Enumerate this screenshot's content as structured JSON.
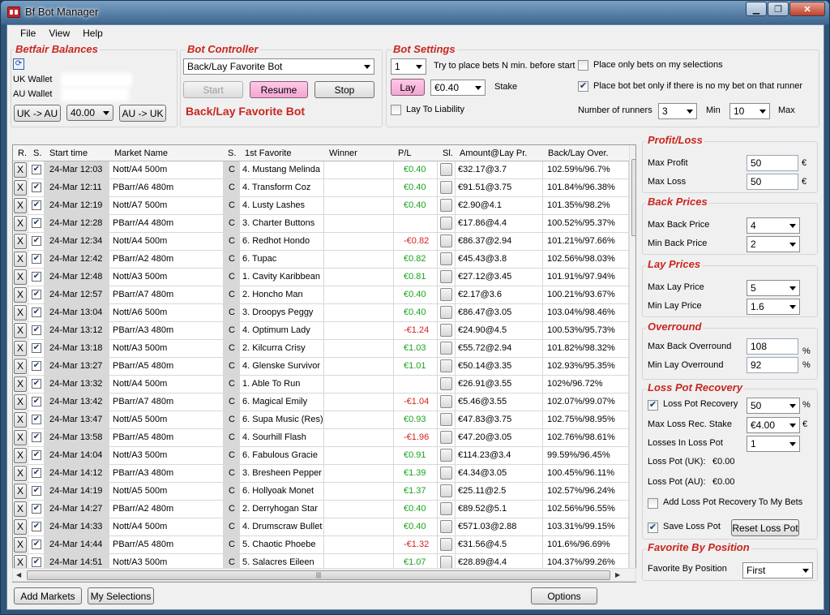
{
  "window": {
    "title": "Bf Bot Manager"
  },
  "menu": {
    "items": [
      "File",
      "View",
      "Help"
    ]
  },
  "balances": {
    "title": "Betfair Balances",
    "uk_label": "UK Wallet",
    "au_label": "AU Wallet",
    "uk_to_au": "UK -> AU",
    "amount": "40.00",
    "au_to_uk": "AU -> UK"
  },
  "controller": {
    "title": "Bot Controller",
    "bot_select": "Back/Lay Favorite Bot",
    "start": "Start",
    "resume": "Resume",
    "stop": "Stop",
    "active_bot": "Back/Lay Favorite Bot"
  },
  "settings": {
    "title": "Bot Settings",
    "minutes": "1",
    "minutes_label": "Try to place bets N min. before start",
    "lay_btn": "Lay",
    "stake": "€0.40",
    "stake_label": "Stake",
    "lay_to_liability": "Lay To Liability",
    "only_selections": "Place only bets on my selections",
    "only_if_no_bet": "Place bot bet only if there is no my bet on that runner",
    "runners_label": "Number of runners",
    "runners_min": "3",
    "min_label": "Min",
    "runners_max": "10",
    "max_label": "Max"
  },
  "grid": {
    "headers": [
      "R.",
      "S.",
      "Start time",
      "Market Name",
      "S.",
      "1st Favorite",
      "Winner",
      "P/L",
      "Sl.",
      "Amount@Lay Pr.",
      "Back/Lay Over."
    ],
    "rows": [
      {
        "time": "24-Mar 12:03",
        "market": "Nott/A4 500m",
        "s": "C",
        "fav": "4. Mustang Melinda",
        "pl": "€0.40",
        "plc": "green",
        "amt": "€32.17@3.7",
        "over": "102.59%/96.7%"
      },
      {
        "time": "24-Mar 12:11",
        "market": "PBarr/A6 480m",
        "s": "C",
        "fav": "4. Transform Coz",
        "pl": "€0.40",
        "plc": "green",
        "amt": "€91.51@3.75",
        "over": "101.84%/96.38%"
      },
      {
        "time": "24-Mar 12:19",
        "market": "Nott/A7 500m",
        "s": "C",
        "fav": "4. Lusty Lashes",
        "pl": "€0.40",
        "plc": "green",
        "amt": "€2.90@4.1",
        "over": "101.35%/98.2%"
      },
      {
        "time": "24-Mar 12:28",
        "market": "PBarr/A4 480m",
        "s": "C",
        "fav": "3. Charter Buttons",
        "pl": "",
        "plc": "",
        "amt": "€17.86@4.4",
        "over": "100.52%/95.37%"
      },
      {
        "time": "24-Mar 12:34",
        "market": "Nott/A4 500m",
        "s": "C",
        "fav": "6. Redhot Hondo",
        "pl": "-€0.82",
        "plc": "red",
        "amt": "€86.37@2.94",
        "over": "101.21%/97.66%"
      },
      {
        "time": "24-Mar 12:42",
        "market": "PBarr/A2 480m",
        "s": "C",
        "fav": "6. Tupac",
        "pl": "€0.82",
        "plc": "green",
        "amt": "€45.43@3.8",
        "over": "102.56%/98.03%"
      },
      {
        "time": "24-Mar 12:48",
        "market": "Nott/A3 500m",
        "s": "C",
        "fav": "1. Cavity Karibbean",
        "pl": "€0.81",
        "plc": "green",
        "amt": "€27.12@3.45",
        "over": "101.91%/97.94%"
      },
      {
        "time": "24-Mar 12:57",
        "market": "PBarr/A7 480m",
        "s": "C",
        "fav": "2. Honcho Man",
        "pl": "€0.40",
        "plc": "green",
        "amt": "€2.17@3.6",
        "over": "100.21%/93.67%"
      },
      {
        "time": "24-Mar 13:04",
        "market": "Nott/A6 500m",
        "s": "C",
        "fav": "3. Droopys Peggy",
        "pl": "€0.40",
        "plc": "green",
        "amt": "€86.47@3.05",
        "over": "103.04%/98.46%"
      },
      {
        "time": "24-Mar 13:12",
        "market": "PBarr/A3 480m",
        "s": "C",
        "fav": "4. Optimum Lady",
        "pl": "-€1.24",
        "plc": "red",
        "amt": "€24.90@4.5",
        "over": "100.53%/95.73%"
      },
      {
        "time": "24-Mar 13:18",
        "market": "Nott/A3 500m",
        "s": "C",
        "fav": "2. Kilcurra Crisy",
        "pl": "€1.03",
        "plc": "green",
        "amt": "€55.72@2.94",
        "over": "101.82%/98.32%"
      },
      {
        "time": "24-Mar 13:27",
        "market": "PBarr/A5 480m",
        "s": "C",
        "fav": "4. Glenske Survivor",
        "pl": "€1.01",
        "plc": "green",
        "amt": "€50.14@3.35",
        "over": "102.93%/95.35%"
      },
      {
        "time": "24-Mar 13:32",
        "market": "Nott/A4 500m",
        "s": "C",
        "fav": "1. Able To Run",
        "pl": "",
        "plc": "",
        "amt": "€26.91@3.55",
        "over": "102%/96.72%"
      },
      {
        "time": "24-Mar 13:42",
        "market": "PBarr/A7 480m",
        "s": "C",
        "fav": "6. Magical Emily",
        "pl": "-€1.04",
        "plc": "red",
        "amt": "€5.46@3.55",
        "over": "102.07%/99.07%"
      },
      {
        "time": "24-Mar 13:47",
        "market": "Nott/A5 500m",
        "s": "C",
        "fav": "6. Supa Music (Res)",
        "pl": "€0.93",
        "plc": "green",
        "amt": "€47.83@3.75",
        "over": "102.75%/98.95%"
      },
      {
        "time": "24-Mar 13:58",
        "market": "PBarr/A5 480m",
        "s": "C",
        "fav": "4. Sourhill Flash",
        "pl": "-€1.96",
        "plc": "red",
        "amt": "€47.20@3.05",
        "over": "102.76%/98.61%"
      },
      {
        "time": "24-Mar 14:04",
        "market": "Nott/A3 500m",
        "s": "C",
        "fav": "6. Fabulous Gracie",
        "pl": "€0.91",
        "plc": "green",
        "amt": "€114.23@3.4",
        "over": "99.59%/96.45%"
      },
      {
        "time": "24-Mar 14:12",
        "market": "PBarr/A3 480m",
        "s": "C",
        "fav": "3. Bresheen Pepper",
        "pl": "€1.39",
        "plc": "green",
        "amt": "€4.34@3.05",
        "over": "100.45%/96.11%"
      },
      {
        "time": "24-Mar 14:19",
        "market": "Nott/A5 500m",
        "s": "C",
        "fav": "6. Hollyoak Monet",
        "pl": "€1.37",
        "plc": "green",
        "amt": "€25.11@2.5",
        "over": "102.57%/96.24%"
      },
      {
        "time": "24-Mar 14:27",
        "market": "PBarr/A2 480m",
        "s": "C",
        "fav": "2. Derryhogan Star",
        "pl": "€0.40",
        "plc": "green",
        "amt": "€89.52@5.1",
        "over": "102.56%/96.55%"
      },
      {
        "time": "24-Mar 14:33",
        "market": "Nott/A4 500m",
        "s": "C",
        "fav": "4. Drumscraw Bullet",
        "pl": "€0.40",
        "plc": "green",
        "amt": "€571.03@2.88",
        "over": "103.31%/99.15%"
      },
      {
        "time": "24-Mar 14:44",
        "market": "PBarr/A5 480m",
        "s": "C",
        "fav": "5. Chaotic Phoebe",
        "pl": "-€1.32",
        "plc": "red",
        "amt": "€31.56@4.5",
        "over": "101.6%/96.69%"
      },
      {
        "time": "24-Mar 14:51",
        "market": "Nott/A3 500m",
        "s": "C",
        "fav": "5. Salacres Eileen",
        "pl": "€1.07",
        "plc": "green",
        "amt": "€28.89@4.4",
        "over": "104.37%/99.26%"
      }
    ]
  },
  "bottom": {
    "add_markets": "Add Markets",
    "my_selections": "My Selections",
    "options": "Options"
  },
  "right": {
    "profit_loss": {
      "title": "Profit/Loss",
      "max_profit_label": "Max Profit",
      "max_profit": "50",
      "max_loss_label": "Max Loss",
      "max_loss": "50",
      "currency": "€"
    },
    "back_prices": {
      "title": "Back Prices",
      "max_label": "Max Back Price",
      "max": "4",
      "min_label": "Min Back Price",
      "min": "2"
    },
    "lay_prices": {
      "title": "Lay Prices",
      "max_label": "Max Lay Price",
      "max": "5",
      "min_label": "Min Lay Price",
      "min": "1.6"
    },
    "overround": {
      "title": "Overround",
      "max_label": "Max Back Overround",
      "max": "108",
      "min_label": "Min Lay Overround",
      "min": "92",
      "pct": "%"
    },
    "loss_pot": {
      "title": "Loss Pot Recovery",
      "recovery_label": "Loss Pot Recovery",
      "recovery": "50",
      "max_stake_label": "Max Loss Rec. Stake",
      "max_stake": "€4.00",
      "losses_label": "Losses In Loss Pot",
      "losses": "1",
      "uk_label": "Loss Pot (UK):",
      "uk": "€0.00",
      "au_label": "Loss Pot (AU):",
      "au": "€0.00",
      "add_label": "Add Loss Pot Recovery To My Bets",
      "save_label": "Save Loss Pot",
      "reset": "Reset Loss Pot",
      "pct": "%",
      "currency": "€"
    },
    "fav_position": {
      "title": "Favorite By Position",
      "label": "Favorite By Position",
      "value": "First"
    }
  }
}
